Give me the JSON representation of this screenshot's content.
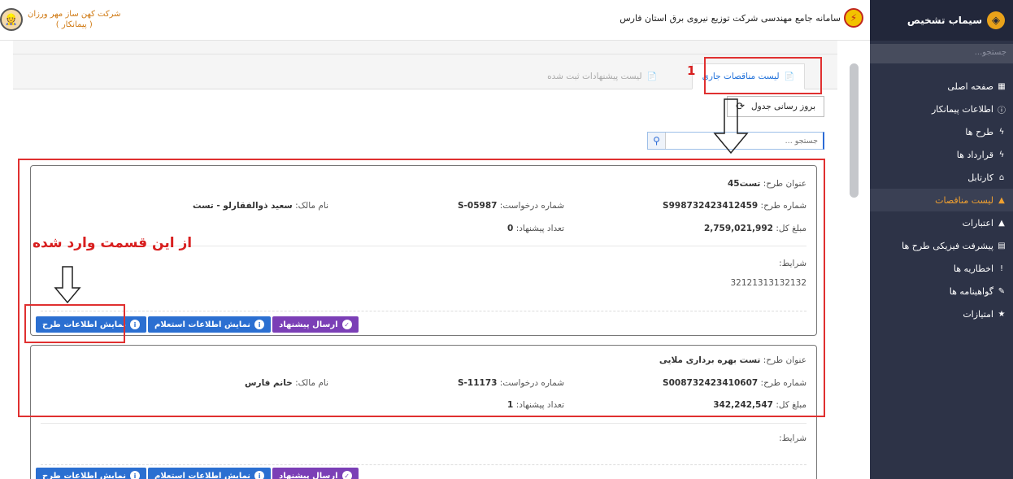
{
  "sidebar": {
    "title": "سیماب تشخیص",
    "search_placeholder": "جستجو...",
    "items": [
      {
        "label": "صفحه اصلی",
        "icon": "dashboard-icon"
      },
      {
        "label": "اطلاعات پیمانکار",
        "icon": "info-icon"
      },
      {
        "label": "طرح ها",
        "icon": "bolt-icon"
      },
      {
        "label": "قرارداد ها",
        "icon": "bolt-icon"
      },
      {
        "label": "کارتابل",
        "icon": "inbox-icon"
      },
      {
        "label": "لیست مناقصات",
        "icon": "tender-icon"
      },
      {
        "label": "اعتبارات",
        "icon": "credit-icon"
      },
      {
        "label": "پیشرفت فیزیکی طرح ها",
        "icon": "progress-icon"
      },
      {
        "label": "اخطاریه ها",
        "icon": "warning-icon"
      },
      {
        "label": "گواهینامه ها",
        "icon": "certificate-icon"
      },
      {
        "label": "امتیازات",
        "icon": "star-icon"
      }
    ],
    "active_index": 5
  },
  "header": {
    "system_title": "سامانه جامع مهندسی شرکت توزیع نیروی برق استان فارس",
    "company_name": "شرکت کهن ساز مهر ورزان",
    "company_role": "( پیمانکار )"
  },
  "tabs": {
    "current_label": "لیست مناقصات جاری",
    "submitted_label": "لیست پیشنهادات ثبت شده"
  },
  "toolbar": {
    "refresh_label": "بروز رسانی جدول",
    "search_placeholder": "جستجو ..."
  },
  "labels": {
    "title": "عنوان طرح:",
    "plan_number": "شماره طرح:",
    "request_number": "شماره درخواست:",
    "owner": "نام مالک:",
    "total": "مبلغ کل:",
    "offers_count": "تعداد پیشنهاد:",
    "conditions": "شرایط:"
  },
  "buttons": {
    "show_plan": "نمایش اطلاعات طرح",
    "show_inquiry": "نمایش اطلاعات استعلام",
    "send_offer": "ارسال پیشنهاد"
  },
  "cards": [
    {
      "title": "تست45",
      "plan_number": "S998732423412459",
      "request_number": "S-05987",
      "owner": "سعید ذوالفقارلو - تست",
      "total": "2,759,021,992",
      "offers_count": "0",
      "conditions": "32121313132132"
    },
    {
      "title": "تست بهره برداری ملایی",
      "plan_number": "S008732423410607",
      "request_number": "S-11173",
      "owner": "خانم فارس",
      "total": "342,242,547",
      "offers_count": "1",
      "conditions": ""
    }
  ],
  "annotations": {
    "step_number": "1",
    "entry_note": "از این قسمت وارد شده"
  },
  "colors": {
    "sidebar_bg": "#2d3347",
    "active_menu": "#f0a030",
    "primary_button": "#2b6fd1",
    "send_button": "#7b3fb6",
    "annotation": "#e03030"
  }
}
